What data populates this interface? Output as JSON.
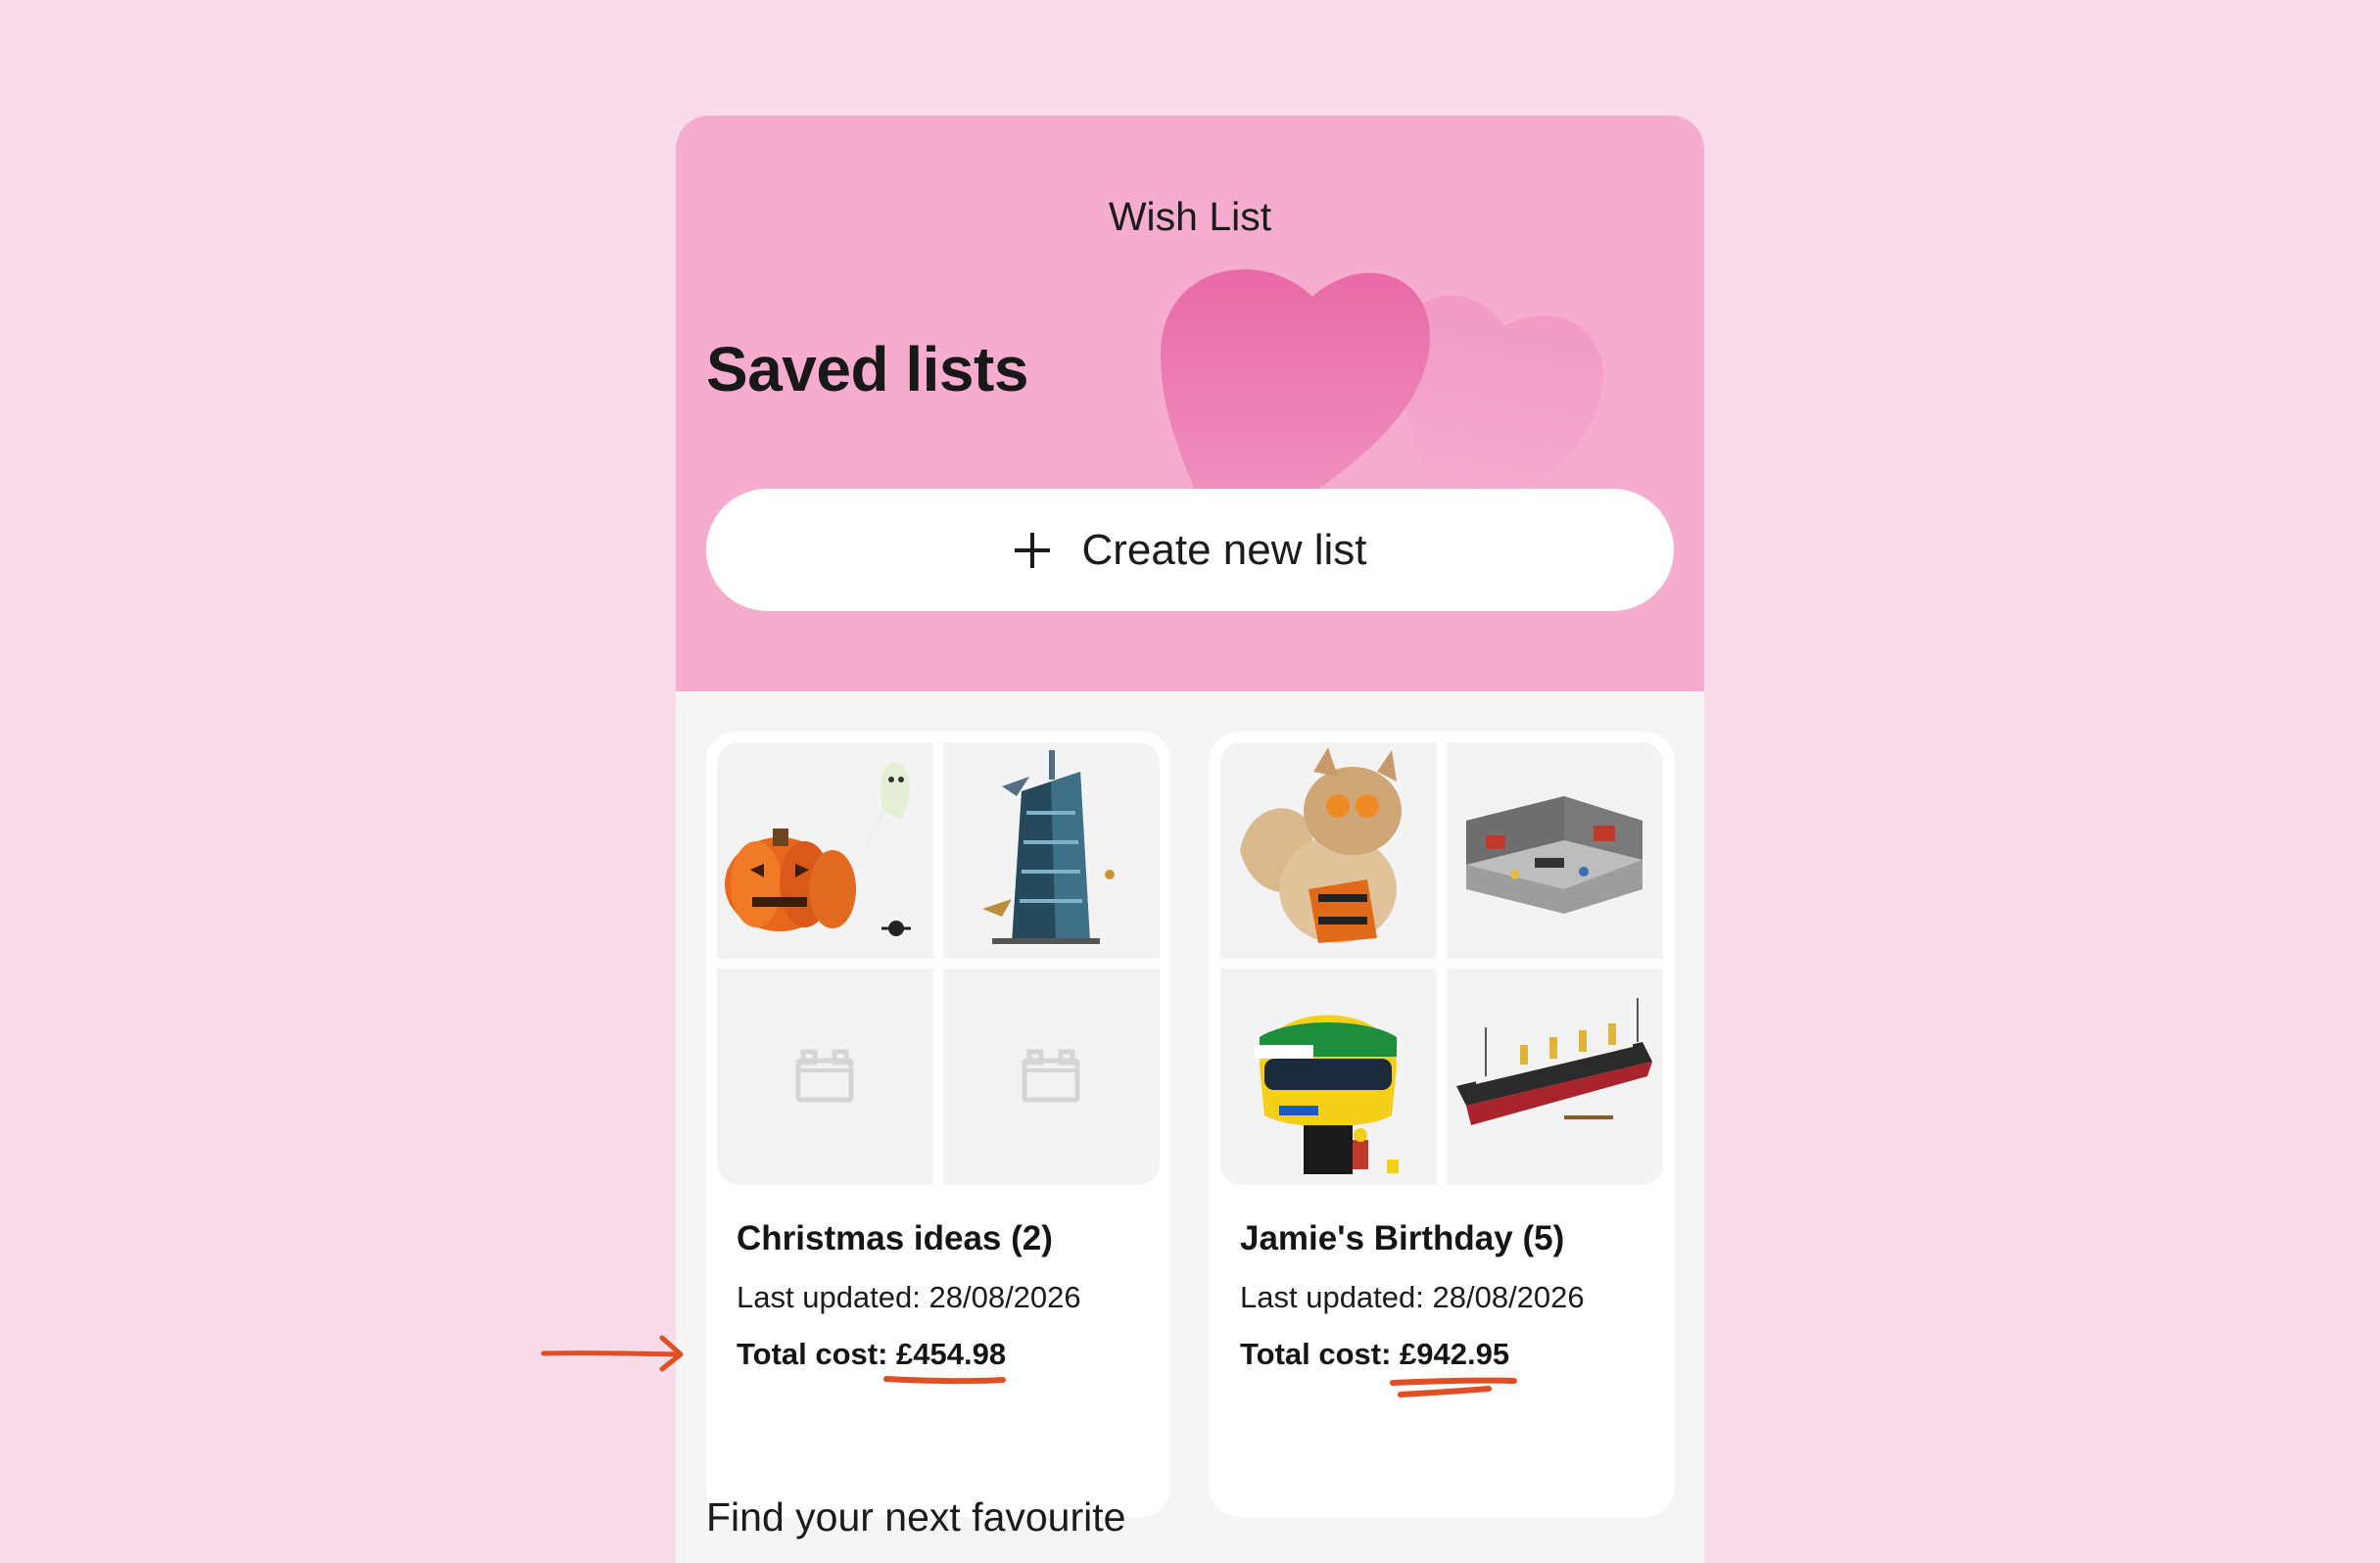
{
  "header": {
    "title": "Wish List"
  },
  "page_title": "Saved lists",
  "create_button": {
    "label": "Create new list",
    "icon": "plus-icon"
  },
  "lists": [
    {
      "name": "Christmas ideas (2)",
      "updated": "Last updated: 28/08/2026",
      "total_label": "Total cost: ",
      "total_value": "£454.98",
      "thumbnails": [
        "pumpkin-set-image",
        "tower-set-image",
        "placeholder-brick-icon",
        "placeholder-brick-icon"
      ]
    },
    {
      "name": "Jamie's Birthday (5)",
      "updated": "Last updated: 28/08/2026",
      "total_label": "Total cost: ",
      "total_value": "£942.95",
      "thumbnails": [
        "creature-set-image",
        "room-set-image",
        "helmet-set-image",
        "ship-set-image"
      ]
    }
  ],
  "section": {
    "title": "Find your next favourite"
  },
  "colors": {
    "page_bg": "#f9dbe9",
    "header_bg": "#f5accd",
    "heart": "#ea6fab",
    "annotation": "#e04e24"
  }
}
